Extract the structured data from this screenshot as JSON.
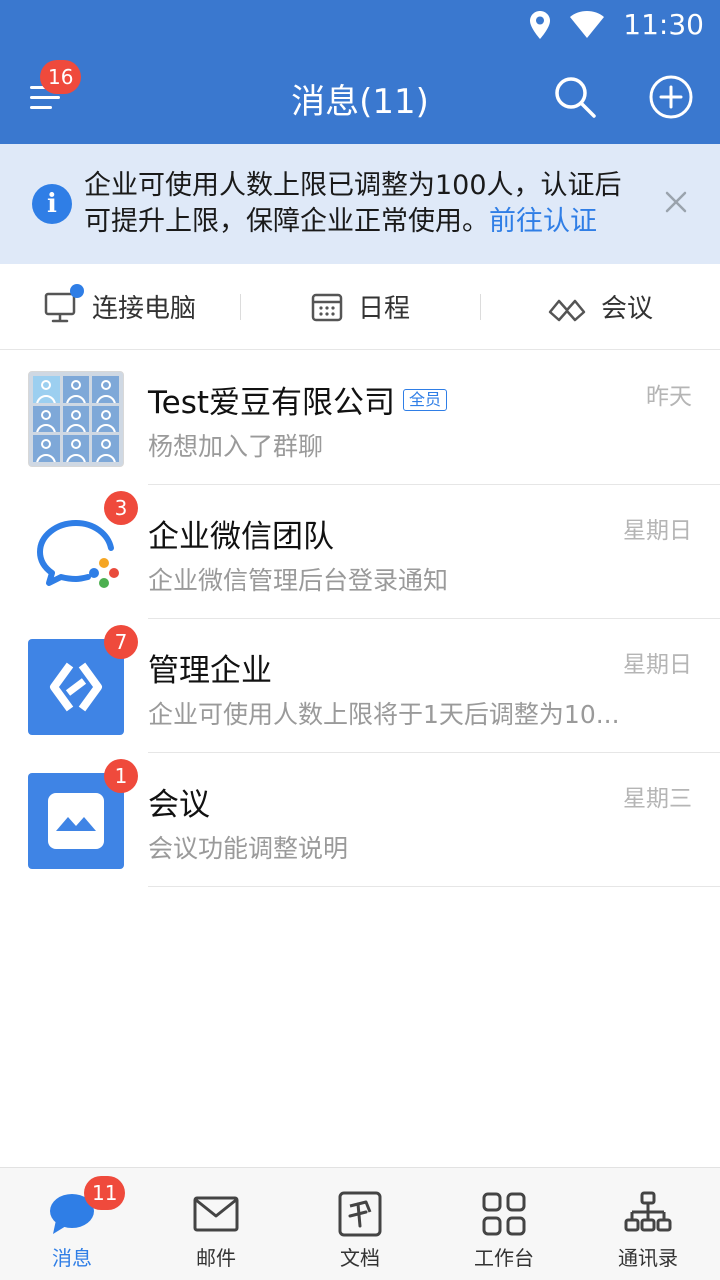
{
  "status_bar": {
    "time": "11:30"
  },
  "header": {
    "title": "消息(11)",
    "menu_badge": "16"
  },
  "notice": {
    "text": "企业可使用人数上限已调整为100人，认证后可提升上限，保障企业正常使用。",
    "link": "前往认证"
  },
  "quick_actions": [
    {
      "label": "连接电脑",
      "icon": "computer-icon"
    },
    {
      "label": "日程",
      "icon": "calendar-icon"
    },
    {
      "label": "会议",
      "icon": "meeting-icon"
    }
  ],
  "conversations": [
    {
      "name": "Test爱豆有限公司",
      "tag": "全员",
      "preview": "杨想加入了群聊",
      "time": "昨天",
      "badge": ""
    },
    {
      "name": "企业微信团队",
      "tag": "",
      "preview": "企业微信管理后台登录通知",
      "time": "星期日",
      "badge": "3"
    },
    {
      "name": "管理企业",
      "tag": "",
      "preview": "企业可使用人数上限将于1天后调整为10...",
      "time": "星期日",
      "badge": "7"
    },
    {
      "name": "会议",
      "tag": "",
      "preview": "会议功能调整说明",
      "time": "星期三",
      "badge": "1"
    }
  ],
  "bottom_nav": [
    {
      "label": "消息",
      "icon": "chat-bubble-icon",
      "badge": "11",
      "active": true
    },
    {
      "label": "邮件",
      "icon": "mail-icon",
      "badge": "",
      "active": false
    },
    {
      "label": "文档",
      "icon": "document-icon",
      "badge": "",
      "active": false
    },
    {
      "label": "工作台",
      "icon": "workbench-grid-icon",
      "badge": "",
      "active": false
    },
    {
      "label": "通讯录",
      "icon": "org-chart-icon",
      "badge": "",
      "active": false
    }
  ],
  "colors": {
    "header_bg": "#3a78cf",
    "accent": "#2f7ee6",
    "badge": "#ef4a3c",
    "notice_bg": "#dfe9f8"
  }
}
